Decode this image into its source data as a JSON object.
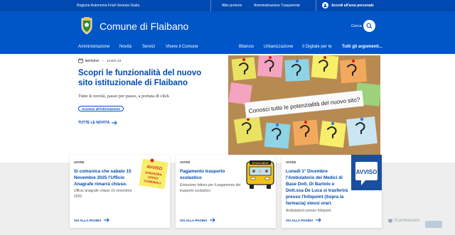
{
  "slim": {
    "region": "Regione Autonoma Friuli Venezia Giulia",
    "links": [
      "Albo pretorio",
      "Amministrazione Trasparente"
    ],
    "user_label": "Accedi all'area personale"
  },
  "header": {
    "title": "Comune di Flaibano",
    "search_label": "Cerca"
  },
  "nav": {
    "left": [
      "Amministrazione",
      "Novità",
      "Servizi",
      "Vivere il Comune"
    ],
    "right": [
      "Bilancio",
      "Urbanizzazione",
      "Il Digitale per te",
      "Tutti gli argomenti..."
    ]
  },
  "hero": {
    "category": "NOTIZIA",
    "date": "14 DIC 23",
    "title_line1": "Scopri le funzionalità del nuovo",
    "title_line2": "sito istituzionale di Flaibano",
    "subtitle": "Tutte le novità, passo per passo, a portata di click",
    "chip": "Accesso all'informazione",
    "all_link": "TUTTE LE NOVITÀ",
    "image_caption": "Conosci tutte le potenzialità del nuovo sito?"
  },
  "cards": [
    {
      "category": "AVVISI",
      "title_lines": [
        "Si comunica che sabato 15",
        "Novembre 2025 l'Ufficio",
        "Anagrafe rimarrà chiuso."
      ],
      "desc_lines": [
        "Ufficio anagrafe chiuso 15 novembre",
        "2025"
      ],
      "more": "VAI ALLA PAGINA",
      "image_text": [
        "AVVISO",
        "CHIUSURA",
        "UFFICI",
        "COMUNALI"
      ]
    },
    {
      "category": "AVVISI",
      "title_lines": [
        "Pagamento trasporto",
        "scolastico"
      ],
      "desc_lines": [
        "Emissione fatture per il pagamento del",
        "trasporto scolastico"
      ],
      "more": "VAI ALLA PAGINA",
      "image_text": [
        "SCUOLABUS"
      ]
    },
    {
      "category": "AVVISI",
      "title_lines": [
        "Lunedì 1° Dicembre",
        "l'Ambulatorio dei Medici di",
        "Base Dott. Di Bartolo e",
        "Dott.ssa De Luca si trasferirà",
        "presso l'Infopoint (Sopra la",
        "farmacia) stessi orari."
      ],
      "desc_lines": [
        "Ambulatorio presso Infopoint"
      ],
      "more": "VAI ALLA PAGINA",
      "image_text": [
        "AVVISO"
      ]
    }
  ],
  "watermark": "ScanMalware",
  "colors": {
    "primary": "#0055c7",
    "slim": "#0049b0",
    "link": "#0049b0"
  }
}
